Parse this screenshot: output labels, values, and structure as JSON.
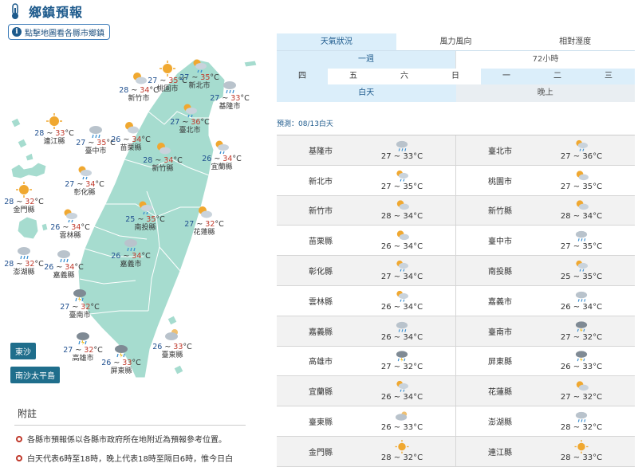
{
  "header": {
    "title": "鄉鎮預報",
    "hint": "點擊地圖看各縣市鄉鎮"
  },
  "tabs": [
    "天氣狀況",
    "風力風向",
    "相對溼度"
  ],
  "ranges": [
    "一週",
    "72小時"
  ],
  "days": [
    "四",
    "五",
    "六",
    "日",
    "一",
    "二",
    "三"
  ],
  "periods": [
    "白天",
    "晚上"
  ],
  "forecast_label": "預測：08/13白天",
  "islands": [
    "東沙",
    "南沙太平島"
  ],
  "notes": {
    "title": "附註",
    "items": [
      "各縣市預報係以各縣市政府所在地附近為預報參考位置。",
      "白天代表6時至18時，晚上代表18時至隔日6時，惟今日白"
    ]
  },
  "map": [
    {
      "name": "新竹市",
      "lo": "28",
      "hi": "34",
      "icon": "sun-cloud"
    },
    {
      "name": "桃園市",
      "lo": "27",
      "hi": "35",
      "icon": "sun"
    },
    {
      "name": "新北市",
      "lo": "27",
      "hi": "35",
      "icon": "sun-cloud-rain"
    },
    {
      "name": "基隆市",
      "lo": "27",
      "hi": "33",
      "icon": "cloud-rain"
    },
    {
      "name": "臺北市",
      "lo": "27",
      "hi": "36",
      "icon": "sun-cloud-rain"
    },
    {
      "name": "連江縣",
      "lo": "28",
      "hi": "33",
      "icon": "sun"
    },
    {
      "name": "臺中市",
      "lo": "27",
      "hi": "35",
      "icon": "cloud-rain"
    },
    {
      "name": "苗栗縣",
      "lo": "26",
      "hi": "34",
      "icon": "sun-cloud"
    },
    {
      "name": "新竹縣",
      "lo": "28",
      "hi": "34",
      "icon": "sun-cloud"
    },
    {
      "name": "宜蘭縣",
      "lo": "26",
      "hi": "34",
      "icon": "sun-cloud-rain"
    },
    {
      "name": "彰化縣",
      "lo": "27",
      "hi": "34",
      "icon": "sun-cloud-rain"
    },
    {
      "name": "金門縣",
      "lo": "28",
      "hi": "32",
      "icon": "sun"
    },
    {
      "name": "南投縣",
      "lo": "25",
      "hi": "35",
      "icon": "sun-cloud-rain"
    },
    {
      "name": "花蓮縣",
      "lo": "27",
      "hi": "32",
      "icon": "sun-cloud"
    },
    {
      "name": "雲林縣",
      "lo": "26",
      "hi": "34",
      "icon": "sun-cloud-rain"
    },
    {
      "name": "澎湖縣",
      "lo": "28",
      "hi": "32",
      "icon": "cloud-rain"
    },
    {
      "name": "嘉義縣",
      "lo": "26",
      "hi": "34",
      "icon": "cloud-rain"
    },
    {
      "name": "嘉義市",
      "lo": "26",
      "hi": "34",
      "icon": "cloud-rain"
    },
    {
      "name": "臺南市",
      "lo": "27",
      "hi": "32",
      "icon": "storm-rain"
    },
    {
      "name": "高雄市",
      "lo": "27",
      "hi": "32",
      "icon": "storm-rain"
    },
    {
      "name": "臺東縣",
      "lo": "26",
      "hi": "33",
      "icon": "cloud-sun"
    },
    {
      "name": "屏東縣",
      "lo": "26",
      "hi": "33",
      "icon": "storm-rain"
    }
  ],
  "table": [
    [
      {
        "name": "基隆市",
        "temp": "27 ~ 33°C",
        "icon": "cloud-rain"
      },
      {
        "name": "臺北市",
        "temp": "27 ~ 36°C",
        "icon": "sun-cloud-rain"
      }
    ],
    [
      {
        "name": "新北市",
        "temp": "27 ~ 35°C",
        "icon": "sun-cloud-rain"
      },
      {
        "name": "桃園市",
        "temp": "27 ~ 35°C",
        "icon": "sun-cloud"
      }
    ],
    [
      {
        "name": "新竹市",
        "temp": "28 ~ 34°C",
        "icon": "sun-cloud"
      },
      {
        "name": "新竹縣",
        "temp": "28 ~ 34°C",
        "icon": "sun-cloud"
      }
    ],
    [
      {
        "name": "苗栗縣",
        "temp": "26 ~ 34°C",
        "icon": "sun-cloud"
      },
      {
        "name": "臺中市",
        "temp": "27 ~ 35°C",
        "icon": "cloud-rain"
      }
    ],
    [
      {
        "name": "彰化縣",
        "temp": "27 ~ 34°C",
        "icon": "sun-cloud-rain"
      },
      {
        "name": "南投縣",
        "temp": "25 ~ 35°C",
        "icon": "sun-cloud-rain"
      }
    ],
    [
      {
        "name": "雲林縣",
        "temp": "26 ~ 34°C",
        "icon": "sun-cloud-rain"
      },
      {
        "name": "嘉義市",
        "temp": "26 ~ 34°C",
        "icon": "cloud-rain"
      }
    ],
    [
      {
        "name": "嘉義縣",
        "temp": "26 ~ 34°C",
        "icon": "cloud-rain"
      },
      {
        "name": "臺南市",
        "temp": "27 ~ 32°C",
        "icon": "storm-rain"
      }
    ],
    [
      {
        "name": "高雄市",
        "temp": "27 ~ 32°C",
        "icon": "storm-rain"
      },
      {
        "name": "屏東縣",
        "temp": "26 ~ 33°C",
        "icon": "storm-rain"
      }
    ],
    [
      {
        "name": "宜蘭縣",
        "temp": "26 ~ 34°C",
        "icon": "sun-cloud-rain"
      },
      {
        "name": "花蓮縣",
        "temp": "27 ~ 32°C",
        "icon": "sun-cloud"
      }
    ],
    [
      {
        "name": "臺東縣",
        "temp": "26 ~ 33°C",
        "icon": "cloud-sun"
      },
      {
        "name": "澎湖縣",
        "temp": "28 ~ 32°C",
        "icon": "cloud-rain"
      }
    ],
    [
      {
        "name": "金門縣",
        "temp": "28 ~ 32°C",
        "icon": "sun"
      },
      {
        "name": "連江縣",
        "temp": "28 ~ 33°C",
        "icon": "sun"
      }
    ]
  ],
  "colors": {
    "land": "#a6dccf",
    "accent": "#1d5a8c",
    "tab_active": "#dbeefa",
    "hi_temp": "#c0392b",
    "lo_temp": "#1f4f8f"
  }
}
